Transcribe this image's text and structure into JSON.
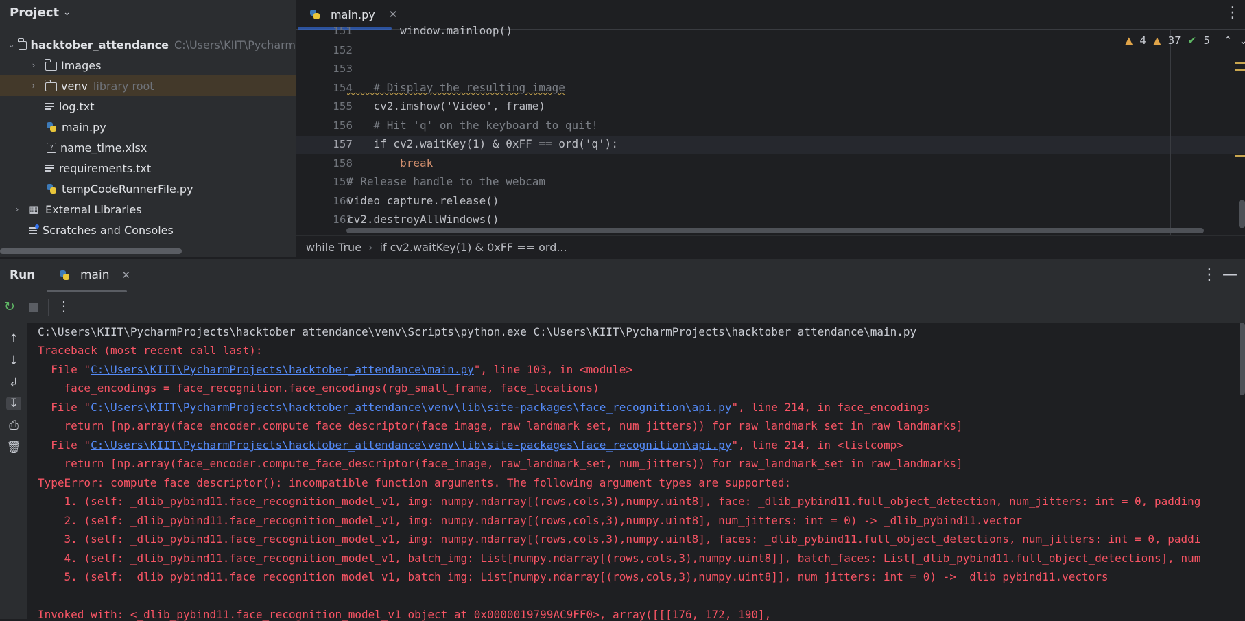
{
  "project": {
    "title": "Project",
    "tree": [
      {
        "label": "hacktober_attendance",
        "extra": "C:\\Users\\KIIT\\Pycharm",
        "kind": "folder",
        "level": 0,
        "chevron": "down"
      },
      {
        "label": "Images",
        "extra": "",
        "kind": "folder",
        "level": 1,
        "chevron": "right"
      },
      {
        "label": "venv",
        "extra": "library root",
        "kind": "folder",
        "level": 1,
        "chevron": "right",
        "selected": true
      },
      {
        "label": "log.txt",
        "extra": "",
        "kind": "text",
        "level": 1
      },
      {
        "label": "main.py",
        "extra": "",
        "kind": "python",
        "level": 1
      },
      {
        "label": "name_time.xlsx",
        "extra": "",
        "kind": "unknown",
        "level": 1
      },
      {
        "label": "requirements.txt",
        "extra": "",
        "kind": "text",
        "level": 1
      },
      {
        "label": "tempCodeRunnerFile.py",
        "extra": "",
        "kind": "python",
        "level": 1
      },
      {
        "label": "External Libraries",
        "extra": "",
        "kind": "library",
        "level": 0,
        "chevron": "right"
      },
      {
        "label": "Scratches and Consoles",
        "extra": "",
        "kind": "scratch",
        "level": 0
      }
    ]
  },
  "editor": {
    "tab_label": "main.py",
    "inspections": {
      "warnings": "4",
      "weak_warnings": "37",
      "ok": "5"
    },
    "lines": [
      {
        "num": "151",
        "text": "        window.mainloop()"
      },
      {
        "num": "152",
        "text": ""
      },
      {
        "num": "153",
        "text": ""
      },
      {
        "num": "154",
        "text": "    # Display the resulting image"
      },
      {
        "num": "155",
        "text": "    cv2.imshow('Video', frame)"
      },
      {
        "num": "156",
        "text": "    # Hit 'q' on the keyboard to quit!"
      },
      {
        "num": "157",
        "text": "    if cv2.waitKey(1) & 0xFF == ord('q'):"
      },
      {
        "num": "158",
        "text": "        break"
      },
      {
        "num": "159",
        "text": "# Release handle to the webcam"
      },
      {
        "num": "160",
        "text": "video_capture.release()"
      },
      {
        "num": "161",
        "text": "cv2.destroyAllWindows()"
      }
    ],
    "current_line": "157",
    "breadcrumb": [
      "while True",
      "if cv2.waitKey(1) & 0xFF == ord..."
    ]
  },
  "run": {
    "title": "Run",
    "tab_label": "main",
    "console": {
      "command": "C:\\Users\\KIIT\\PycharmProjects\\hacktober_attendance\\venv\\Scripts\\python.exe C:\\Users\\KIIT\\PycharmProjects\\hacktober_attendance\\main.py",
      "traceback_header": "Traceback (most recent call last):",
      "frames": [
        {
          "prefix": "  File \"",
          "path": "C:\\Users\\KIIT\\PycharmProjects\\hacktober_attendance\\main.py",
          "suffix": "\", line 103, in <module>",
          "code": "    face_encodings = face_recognition.face_encodings(rgb_small_frame, face_locations)"
        },
        {
          "prefix": "  File \"",
          "path": "C:\\Users\\KIIT\\PycharmProjects\\hacktober_attendance\\venv\\lib\\site-packages\\face_recognition\\api.py",
          "suffix": "\", line 214, in face_encodings",
          "code": "    return [np.array(face_encoder.compute_face_descriptor(face_image, raw_landmark_set, num_jitters)) for raw_landmark_set in raw_landmarks]"
        },
        {
          "prefix": "  File \"",
          "path": "C:\\Users\\KIIT\\PycharmProjects\\hacktober_attendance\\venv\\lib\\site-packages\\face_recognition\\api.py",
          "suffix": "\", line 214, in <listcomp>",
          "code": "    return [np.array(face_encoder.compute_face_descriptor(face_image, raw_landmark_set, num_jitters)) for raw_landmark_set in raw_landmarks]"
        }
      ],
      "error": "TypeError: compute_face_descriptor(): incompatible function arguments. The following argument types are supported:",
      "overloads": [
        "    1. (self: _dlib_pybind11.face_recognition_model_v1, img: numpy.ndarray[(rows,cols,3),numpy.uint8], face: _dlib_pybind11.full_object_detection, num_jitters: int = 0, padding",
        "    2. (self: _dlib_pybind11.face_recognition_model_v1, img: numpy.ndarray[(rows,cols,3),numpy.uint8], num_jitters: int = 0) -> _dlib_pybind11.vector",
        "    3. (self: _dlib_pybind11.face_recognition_model_v1, img: numpy.ndarray[(rows,cols,3),numpy.uint8], faces: _dlib_pybind11.full_object_detections, num_jitters: int = 0, paddi",
        "    4. (self: _dlib_pybind11.face_recognition_model_v1, batch_img: List[numpy.ndarray[(rows,cols,3),numpy.uint8]], batch_faces: List[_dlib_pybind11.full_object_detections], num",
        "    5. (self: _dlib_pybind11.face_recognition_model_v1, batch_img: List[numpy.ndarray[(rows,cols,3),numpy.uint8]], num_jitters: int = 0) -> _dlib_pybind11.vectors"
      ],
      "invoked": "Invoked with: <_dlib_pybind11.face_recognition_model_v1 object at 0x0000019799AC9FF0>, array([[[176, 172, 190],"
    }
  },
  "colors": {
    "accent": "#3574f0",
    "error": "#f75464",
    "link": "#548af7",
    "selected_row": "#43392a"
  }
}
